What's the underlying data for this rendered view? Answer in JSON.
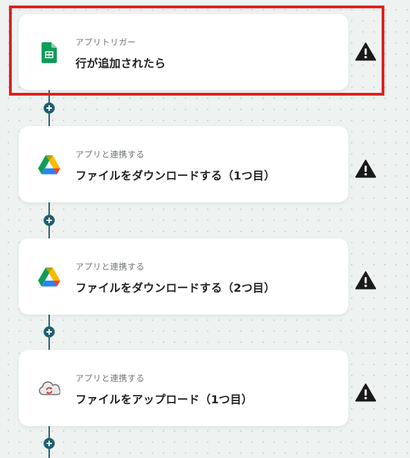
{
  "steps": [
    {
      "app_icon": "google-sheets-icon",
      "subtitle": "アプリトリガー",
      "title": "行が追加されたら",
      "status_icon": "warning-icon",
      "highlighted": true
    },
    {
      "app_icon": "google-drive-icon",
      "subtitle": "アプリと連携する",
      "title": "ファイルをダウンロードする（1つ目）",
      "status_icon": "warning-icon",
      "highlighted": false
    },
    {
      "app_icon": "google-drive-icon",
      "subtitle": "アプリと連携する",
      "title": "ファイルをダウンロードする（2つ目）",
      "status_icon": "warning-icon",
      "highlighted": false
    },
    {
      "app_icon": "cloud-sync-icon",
      "subtitle": "アプリと連携する",
      "title": "ファイルをアップロード（1つ目）",
      "status_icon": "warning-icon",
      "highlighted": false
    }
  ],
  "colors": {
    "highlight_border": "#e0201f",
    "connector": "#245d6e",
    "add_button": "#1f5f70",
    "warning": "#1a1a1a"
  }
}
